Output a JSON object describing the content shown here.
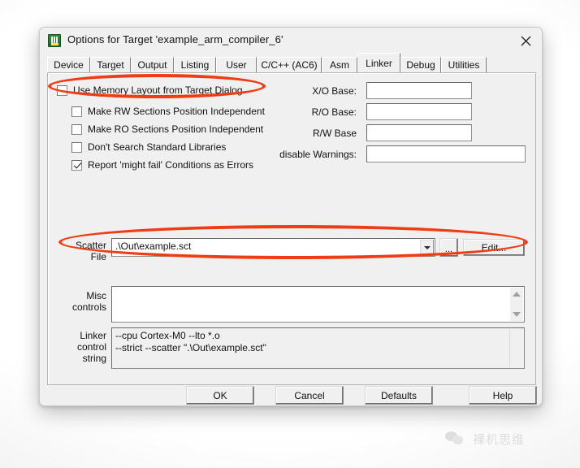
{
  "window": {
    "title": "Options for Target 'example_arm_compiler_6'",
    "icon": "keil-uvision-icon",
    "close_label": "✕"
  },
  "tabs": [
    {
      "label": "Device",
      "selected": false
    },
    {
      "label": "Target",
      "selected": false
    },
    {
      "label": "Output",
      "selected": false
    },
    {
      "label": "Listing",
      "selected": false
    },
    {
      "label": "User",
      "selected": false
    },
    {
      "label": "C/C++ (AC6)",
      "selected": false
    },
    {
      "label": "Asm",
      "selected": false
    },
    {
      "label": "Linker",
      "selected": true
    },
    {
      "label": "Debug",
      "selected": false
    },
    {
      "label": "Utilities",
      "selected": false
    }
  ],
  "linker": {
    "checkboxes": [
      {
        "label": "Use Memory Layout from Target Dialog",
        "checked": false
      },
      {
        "label": "Make RW Sections Position Independent",
        "checked": false
      },
      {
        "label": "Make RO Sections Position Independent",
        "checked": false
      },
      {
        "label": "Don't Search Standard Libraries",
        "checked": false
      },
      {
        "label": "Report 'might fail' Conditions as Errors",
        "checked": true
      }
    ],
    "fields": [
      {
        "label": "X/O Base:",
        "value": ""
      },
      {
        "label": "R/O Base:",
        "value": ""
      },
      {
        "label": "R/W Base",
        "value": ""
      },
      {
        "label": "disable Warnings:",
        "value": ""
      }
    ],
    "scatter": {
      "label_line1": "Scatter",
      "label_line2": "File",
      "value": ".\\Out\\example.sct",
      "browse_label": "...",
      "edit_label": "Edit..."
    },
    "misc": {
      "label_line1": "Misc",
      "label_line2": "controls",
      "value": ""
    },
    "control_string": {
      "label_line1": "Linker",
      "label_line2": "control",
      "label_line3": "string",
      "value": "--cpu Cortex-M0 --lto *.o\n--strict --scatter \".\\Out\\example.sct\""
    }
  },
  "footer": {
    "ok_label": "OK",
    "cancel_label": "Cancel",
    "defaults_label": "Defaults",
    "help_label": "Help"
  },
  "watermark": {
    "text": "裸机思维",
    "icon": "wechat-icon"
  },
  "annotations": {
    "color": "#f03c14",
    "shapes": [
      {
        "name": "highlight-use-memory-layout"
      },
      {
        "name": "highlight-scatter-file"
      }
    ]
  }
}
